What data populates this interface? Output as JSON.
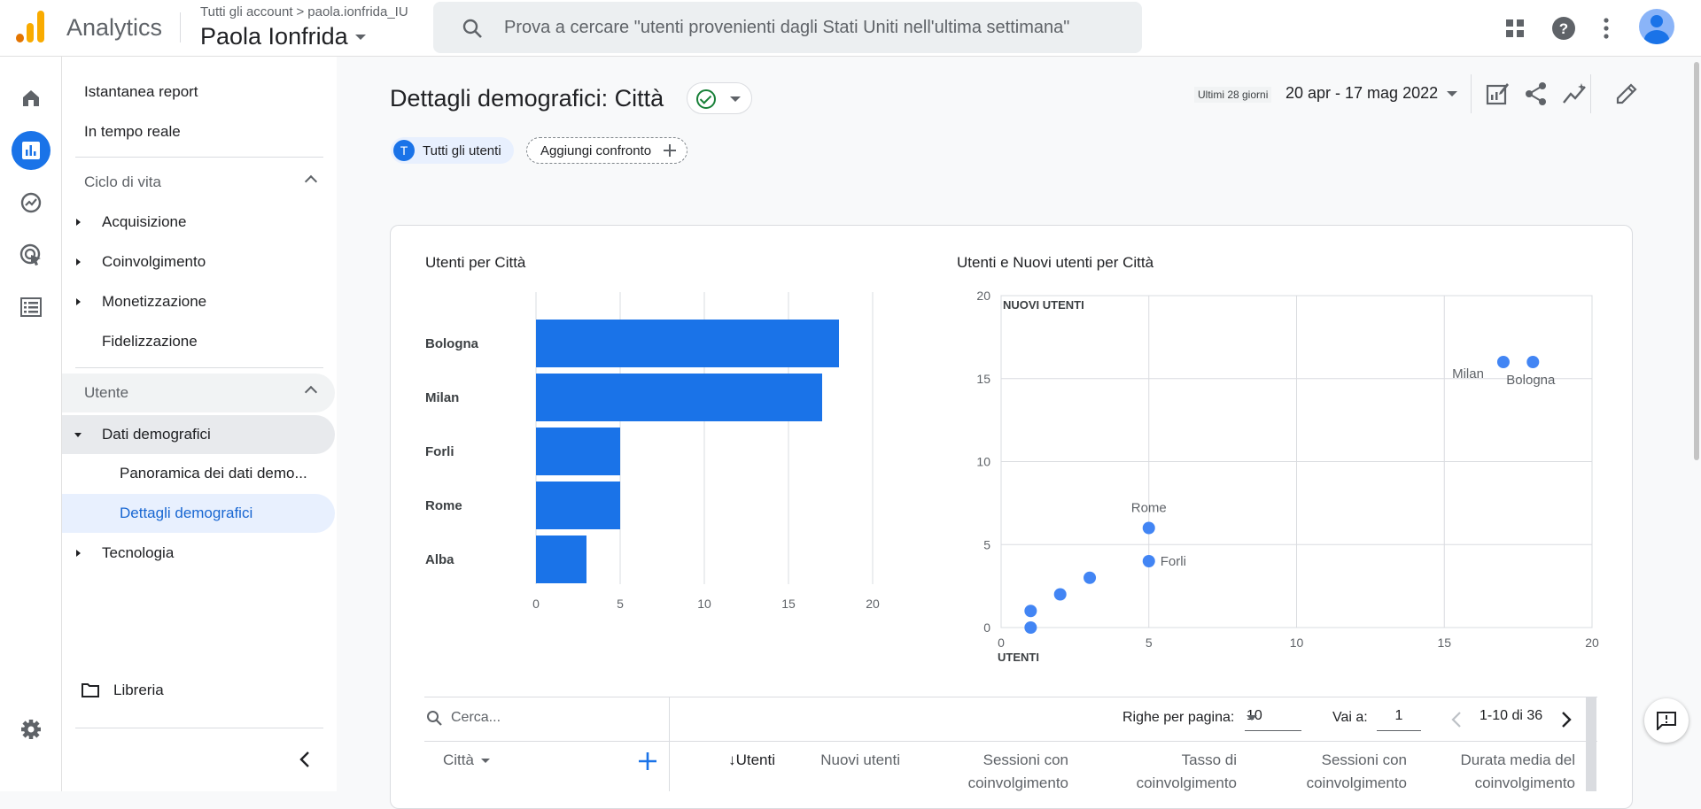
{
  "app": {
    "name": "Analytics",
    "breadcrumb_root": "Tutti gli account",
    "breadcrumb_property": "paola.ionfrida_IU",
    "account_name": "Paola Ionfrida"
  },
  "search": {
    "placeholder": "Prova a cercare \"utenti provenienti dagli Stati Uniti nell'ultima settimana\""
  },
  "topbar_icons": [
    "apps-icon",
    "help-icon",
    "more-vert-icon",
    "account-avatar"
  ],
  "rail_icons": [
    "home-icon",
    "reports-icon",
    "explore-icon",
    "advertising-icon",
    "configure-icon",
    "settings-icon"
  ],
  "nav": {
    "snapshot": "Istantanea report",
    "realtime": "In tempo reale",
    "lifecycle": {
      "label": "Ciclo di vita",
      "items": [
        "Acquisizione",
        "Coinvolgimento",
        "Monetizzazione",
        "Fidelizzazione"
      ]
    },
    "user": {
      "label": "Utente",
      "demographics": "Dati demografici",
      "overview": "Panoramica dei dati demo...",
      "details": "Dettagli demografici",
      "tech": "Tecnologia"
    },
    "library": "Libreria"
  },
  "page": {
    "title": "Dettagli demografici: Città",
    "date_label": "Ultimi 28 giorni",
    "date_range": "20 apr - 17 mag 2022",
    "segment_initial": "T",
    "segment": "Tutti gli utenti",
    "add_comparison": "Aggiungi confronto"
  },
  "colors": {
    "accent": "#1a73e8",
    "dot": "#4285f4",
    "ok": "#188038"
  },
  "chart_data": [
    {
      "type": "bar",
      "title": "Utenti per Città",
      "orientation": "horizontal",
      "categories": [
        "Bologna",
        "Milan",
        "Forli",
        "Rome",
        "Alba"
      ],
      "values": [
        18,
        17,
        5,
        5,
        3
      ],
      "xlim": [
        0,
        20
      ],
      "xticks": [
        "0",
        "5",
        "10",
        "15",
        "20"
      ]
    },
    {
      "type": "scatter",
      "title": "Utenti e Nuovi utenti per Città",
      "xlabel": "UTENTI",
      "ylabel": "NUOVI UTENTI",
      "xlim": [
        0,
        20
      ],
      "ylim": [
        0,
        20
      ],
      "xticks": [
        "0",
        "5",
        "10",
        "15",
        "20"
      ],
      "yticks": [
        "0",
        "5",
        "10",
        "15",
        "20"
      ],
      "points": [
        {
          "x": 17,
          "y": 16,
          "label": "Milan"
        },
        {
          "x": 18,
          "y": 16,
          "label": "Bologna"
        },
        {
          "x": 5,
          "y": 6,
          "label": "Rome"
        },
        {
          "x": 5,
          "y": 4,
          "label": "Forli"
        },
        {
          "x": 3,
          "y": 3,
          "label": ""
        },
        {
          "x": 2,
          "y": 2,
          "label": ""
        },
        {
          "x": 1,
          "y": 1,
          "label": ""
        },
        {
          "x": 1,
          "y": 0,
          "label": ""
        }
      ]
    }
  ],
  "table": {
    "search_placeholder": "Cerca...",
    "rows_per_page_label": "Righe per pagina:",
    "rows_per_page": "10",
    "goto_label": "Vai a:",
    "goto_value": "1",
    "page_info": "1-10 di 36",
    "dimension": "Città",
    "sort_arrow": "↓",
    "columns": [
      "Utenti",
      "Nuovi utenti",
      "Sessioni con",
      "coinvolgimento",
      "Tasso di",
      "coinvolgimento",
      "Sessioni con",
      "coinvolgimento",
      "Durata media del",
      "coinvolgimento"
    ]
  }
}
